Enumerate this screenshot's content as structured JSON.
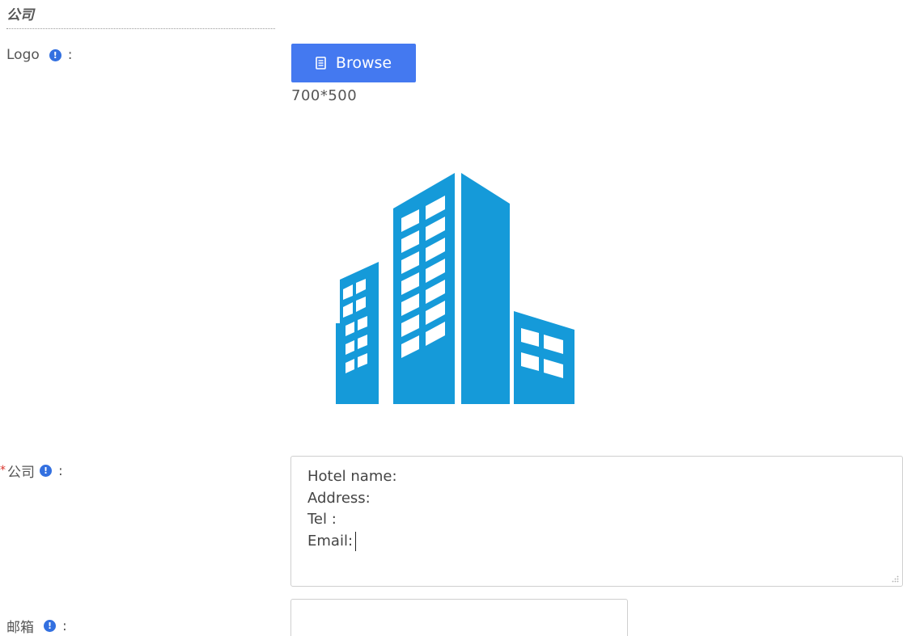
{
  "section": {
    "title": "公司"
  },
  "logo_field": {
    "label": "Logo",
    "colon": ":",
    "browse_label": "Browse",
    "size_hint": "700*500"
  },
  "company_field": {
    "required_mark": "*",
    "label": "公司",
    "colon": ":",
    "lines": [
      "Hotel name:",
      "Address:",
      "Tel :",
      "Email:"
    ]
  },
  "email_field": {
    "label": "邮箱",
    "colon": ":",
    "value": ""
  },
  "info_icon_glyph": "!",
  "colors": {
    "accent": "#4479f0",
    "info": "#3370e0",
    "building": "#159ad9",
    "required": "#d9342b"
  },
  "icons": {
    "info": "info-icon",
    "file": "file-icon",
    "logo": "building-icon"
  }
}
